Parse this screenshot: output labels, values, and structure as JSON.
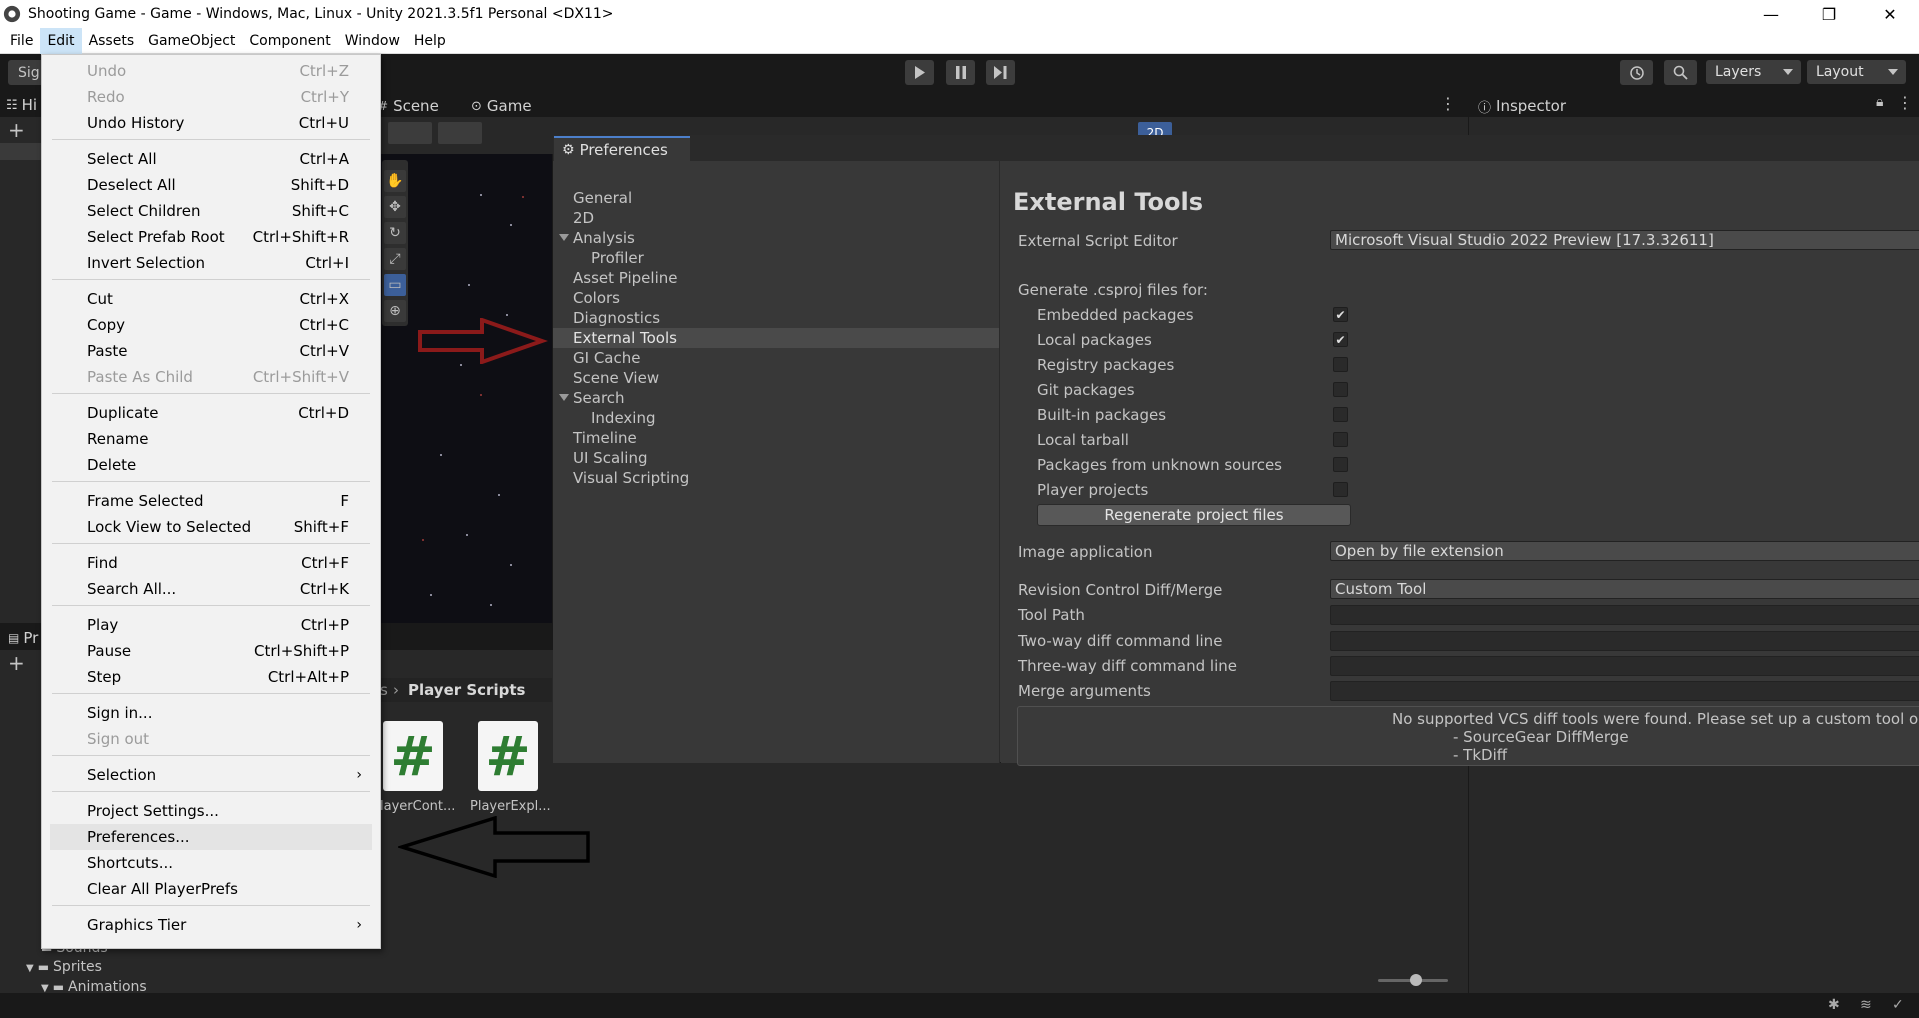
{
  "window": {
    "title": "Shooting Game - Game - Windows, Mac, Linux - Unity 2021.3.5f1 Personal <DX11>",
    "minimize": "—",
    "maximize": "❐",
    "close": "✕"
  },
  "menubar": {
    "items": [
      "File",
      "Edit",
      "Assets",
      "GameObject",
      "Component",
      "Window",
      "Help"
    ]
  },
  "toolbar": {
    "account_label": "Sig",
    "layers_label": "Layers",
    "layout_label": "Layout"
  },
  "tabs": {
    "hierarchy": "Hi",
    "scene": "Scene",
    "game": "Game",
    "inspector": "Inspector",
    "project": "Pr",
    "scene_2d": "2D"
  },
  "project": {
    "breadcrumb_prefix": "s",
    "breadcrumb_current": "Player Scripts",
    "assets": [
      "layerCont...",
      "PlayerExpl..."
    ],
    "tree": [
      "Sounds",
      "Sprites",
      "Animations"
    ]
  },
  "edit_menu": {
    "items": [
      {
        "label": "Undo",
        "shortcut": "Ctrl+Z",
        "disabled": true
      },
      {
        "label": "Redo",
        "shortcut": "Ctrl+Y",
        "disabled": true
      },
      {
        "label": "Undo History",
        "shortcut": "Ctrl+U"
      },
      {
        "label": "Select All",
        "shortcut": "Ctrl+A"
      },
      {
        "label": "Deselect All",
        "shortcut": "Shift+D"
      },
      {
        "label": "Select Children",
        "shortcut": "Shift+C"
      },
      {
        "label": "Select Prefab Root",
        "shortcut": "Ctrl+Shift+R"
      },
      {
        "label": "Invert Selection",
        "shortcut": "Ctrl+I"
      },
      {
        "label": "Cut",
        "shortcut": "Ctrl+X"
      },
      {
        "label": "Copy",
        "shortcut": "Ctrl+C"
      },
      {
        "label": "Paste",
        "shortcut": "Ctrl+V"
      },
      {
        "label": "Paste As Child",
        "shortcut": "Ctrl+Shift+V",
        "disabled": true
      },
      {
        "label": "Duplicate",
        "shortcut": "Ctrl+D"
      },
      {
        "label": "Rename",
        "shortcut": ""
      },
      {
        "label": "Delete",
        "shortcut": ""
      },
      {
        "label": "Frame Selected",
        "shortcut": "F"
      },
      {
        "label": "Lock View to Selected",
        "shortcut": "Shift+F"
      },
      {
        "label": "Find",
        "shortcut": "Ctrl+F"
      },
      {
        "label": "Search All...",
        "shortcut": "Ctrl+K"
      },
      {
        "label": "Play",
        "shortcut": "Ctrl+P"
      },
      {
        "label": "Pause",
        "shortcut": "Ctrl+Shift+P"
      },
      {
        "label": "Step",
        "shortcut": "Ctrl+Alt+P"
      },
      {
        "label": "Sign in...",
        "shortcut": ""
      },
      {
        "label": "Sign out",
        "shortcut": "",
        "disabled": true
      },
      {
        "label": "Selection",
        "shortcut": "",
        "submenu": true
      },
      {
        "label": "Project Settings...",
        "shortcut": ""
      },
      {
        "label": "Preferences...",
        "shortcut": "",
        "highlighted": true
      },
      {
        "label": "Shortcuts...",
        "shortcut": ""
      },
      {
        "label": "Clear All PlayerPrefs",
        "shortcut": ""
      },
      {
        "label": "Graphics Tier",
        "shortcut": "",
        "submenu": true
      }
    ]
  },
  "preferences": {
    "window_title": "Preferences",
    "nav": [
      {
        "label": "General",
        "level": 0
      },
      {
        "label": "2D",
        "level": 0
      },
      {
        "label": "Analysis",
        "level": 0,
        "foldout": true
      },
      {
        "label": "Profiler",
        "level": 1
      },
      {
        "label": "Asset Pipeline",
        "level": 0
      },
      {
        "label": "Colors",
        "level": 0
      },
      {
        "label": "Diagnostics",
        "level": 0
      },
      {
        "label": "External Tools",
        "level": 0,
        "selected": true
      },
      {
        "label": "GI Cache",
        "level": 0
      },
      {
        "label": "Scene View",
        "level": 0
      },
      {
        "label": "Search",
        "level": 0,
        "foldout": true
      },
      {
        "label": "Indexing",
        "level": 1
      },
      {
        "label": "Timeline",
        "level": 0
      },
      {
        "label": "UI Scaling",
        "level": 0
      },
      {
        "label": "Visual Scripting",
        "level": 0
      }
    ],
    "section_title": "External Tools",
    "external_script_editor_label": "External Script Editor",
    "external_script_editor_value": "Microsoft Visual Studio 2022 Preview [17.3.32611]",
    "csproj_label": "Generate .csproj files for:",
    "csproj_options": [
      {
        "label": "Embedded packages",
        "checked": true
      },
      {
        "label": "Local packages",
        "checked": true
      },
      {
        "label": "Registry packages",
        "checked": false
      },
      {
        "label": "Git packages",
        "checked": false
      },
      {
        "label": "Built-in packages",
        "checked": false
      },
      {
        "label": "Local tarball",
        "checked": false
      },
      {
        "label": "Packages from unknown sources",
        "checked": false
      },
      {
        "label": "Player projects",
        "checked": false
      }
    ],
    "regen_button": "Regenerate project files",
    "image_app_label": "Image application",
    "image_app_value": "Open by file extension",
    "vcs_label": "Revision Control Diff/Merge",
    "vcs_value": "Custom Tool",
    "tool_path_label": "Tool Path",
    "two_way_label": "Two-way diff command line",
    "three_way_label": "Three-way diff command line",
    "merge_args_label": "Merge arguments",
    "vcs_help_line1": "No supported VCS diff tools were found. Please set up a custom tool or ins",
    "vcs_help_line2": "- SourceGear DiffMerge",
    "vcs_help_line3": "- TkDiff"
  },
  "colors": {
    "arrow_red": "#8b1a1a",
    "arrow_black": "#000000",
    "selection_blue": "#4c7fca"
  }
}
